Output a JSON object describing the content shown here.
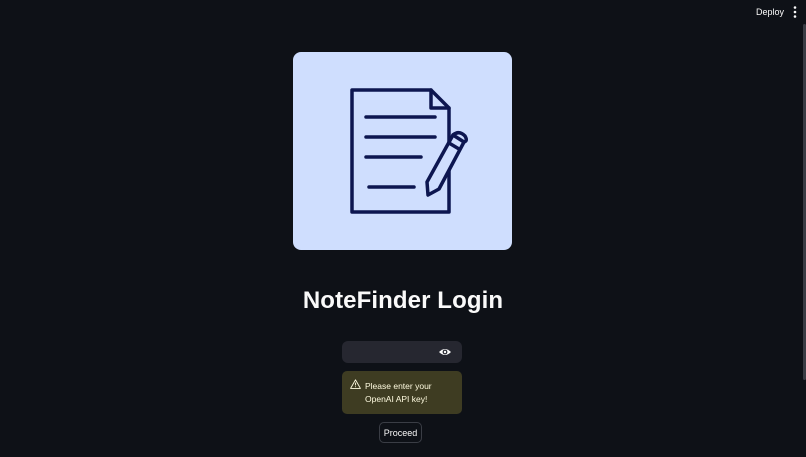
{
  "header": {
    "deploy_label": "Deploy",
    "menu_icon": "vertical-dots-icon"
  },
  "hero": {
    "icon": "document-with-pencil-icon",
    "background": "#cfdefe",
    "stroke": "#0d1650"
  },
  "login": {
    "title": "NoteFinder Login",
    "api_key_input": {
      "value": "",
      "placeholder": "",
      "toggle_icon": "eye-icon"
    },
    "warning": {
      "icon": "warning-triangle-icon",
      "text": "Please enter your OpenAI API key!"
    },
    "proceed_label": "Proceed"
  },
  "colors": {
    "background": "#0e1117",
    "input_bg": "#262730",
    "warning_bg": "#3e3c22",
    "warning_text": "#fffbe0"
  }
}
